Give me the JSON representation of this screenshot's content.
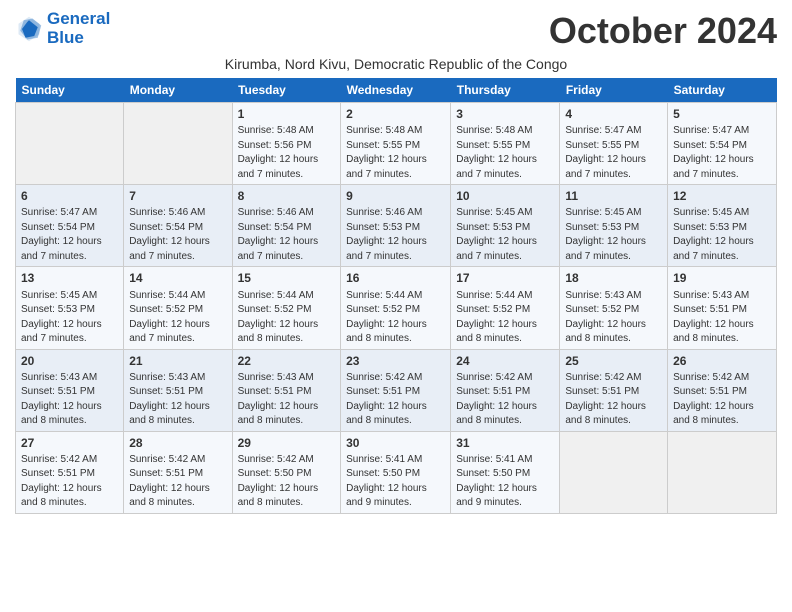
{
  "header": {
    "logo_line1": "General",
    "logo_line2": "Blue",
    "month": "October 2024",
    "location": "Kirumba, Nord Kivu, Democratic Republic of the Congo"
  },
  "weekdays": [
    "Sunday",
    "Monday",
    "Tuesday",
    "Wednesday",
    "Thursday",
    "Friday",
    "Saturday"
  ],
  "weeks": [
    [
      {
        "day": "",
        "detail": ""
      },
      {
        "day": "",
        "detail": ""
      },
      {
        "day": "1",
        "detail": "Sunrise: 5:48 AM\nSunset: 5:56 PM\nDaylight: 12 hours\nand 7 minutes."
      },
      {
        "day": "2",
        "detail": "Sunrise: 5:48 AM\nSunset: 5:55 PM\nDaylight: 12 hours\nand 7 minutes."
      },
      {
        "day": "3",
        "detail": "Sunrise: 5:48 AM\nSunset: 5:55 PM\nDaylight: 12 hours\nand 7 minutes."
      },
      {
        "day": "4",
        "detail": "Sunrise: 5:47 AM\nSunset: 5:55 PM\nDaylight: 12 hours\nand 7 minutes."
      },
      {
        "day": "5",
        "detail": "Sunrise: 5:47 AM\nSunset: 5:54 PM\nDaylight: 12 hours\nand 7 minutes."
      }
    ],
    [
      {
        "day": "6",
        "detail": "Sunrise: 5:47 AM\nSunset: 5:54 PM\nDaylight: 12 hours\nand 7 minutes."
      },
      {
        "day": "7",
        "detail": "Sunrise: 5:46 AM\nSunset: 5:54 PM\nDaylight: 12 hours\nand 7 minutes."
      },
      {
        "day": "8",
        "detail": "Sunrise: 5:46 AM\nSunset: 5:54 PM\nDaylight: 12 hours\nand 7 minutes."
      },
      {
        "day": "9",
        "detail": "Sunrise: 5:46 AM\nSunset: 5:53 PM\nDaylight: 12 hours\nand 7 minutes."
      },
      {
        "day": "10",
        "detail": "Sunrise: 5:45 AM\nSunset: 5:53 PM\nDaylight: 12 hours\nand 7 minutes."
      },
      {
        "day": "11",
        "detail": "Sunrise: 5:45 AM\nSunset: 5:53 PM\nDaylight: 12 hours\nand 7 minutes."
      },
      {
        "day": "12",
        "detail": "Sunrise: 5:45 AM\nSunset: 5:53 PM\nDaylight: 12 hours\nand 7 minutes."
      }
    ],
    [
      {
        "day": "13",
        "detail": "Sunrise: 5:45 AM\nSunset: 5:53 PM\nDaylight: 12 hours\nand 7 minutes."
      },
      {
        "day": "14",
        "detail": "Sunrise: 5:44 AM\nSunset: 5:52 PM\nDaylight: 12 hours\nand 7 minutes."
      },
      {
        "day": "15",
        "detail": "Sunrise: 5:44 AM\nSunset: 5:52 PM\nDaylight: 12 hours\nand 8 minutes."
      },
      {
        "day": "16",
        "detail": "Sunrise: 5:44 AM\nSunset: 5:52 PM\nDaylight: 12 hours\nand 8 minutes."
      },
      {
        "day": "17",
        "detail": "Sunrise: 5:44 AM\nSunset: 5:52 PM\nDaylight: 12 hours\nand 8 minutes."
      },
      {
        "day": "18",
        "detail": "Sunrise: 5:43 AM\nSunset: 5:52 PM\nDaylight: 12 hours\nand 8 minutes."
      },
      {
        "day": "19",
        "detail": "Sunrise: 5:43 AM\nSunset: 5:51 PM\nDaylight: 12 hours\nand 8 minutes."
      }
    ],
    [
      {
        "day": "20",
        "detail": "Sunrise: 5:43 AM\nSunset: 5:51 PM\nDaylight: 12 hours\nand 8 minutes."
      },
      {
        "day": "21",
        "detail": "Sunrise: 5:43 AM\nSunset: 5:51 PM\nDaylight: 12 hours\nand 8 minutes."
      },
      {
        "day": "22",
        "detail": "Sunrise: 5:43 AM\nSunset: 5:51 PM\nDaylight: 12 hours\nand 8 minutes."
      },
      {
        "day": "23",
        "detail": "Sunrise: 5:42 AM\nSunset: 5:51 PM\nDaylight: 12 hours\nand 8 minutes."
      },
      {
        "day": "24",
        "detail": "Sunrise: 5:42 AM\nSunset: 5:51 PM\nDaylight: 12 hours\nand 8 minutes."
      },
      {
        "day": "25",
        "detail": "Sunrise: 5:42 AM\nSunset: 5:51 PM\nDaylight: 12 hours\nand 8 minutes."
      },
      {
        "day": "26",
        "detail": "Sunrise: 5:42 AM\nSunset: 5:51 PM\nDaylight: 12 hours\nand 8 minutes."
      }
    ],
    [
      {
        "day": "27",
        "detail": "Sunrise: 5:42 AM\nSunset: 5:51 PM\nDaylight: 12 hours\nand 8 minutes."
      },
      {
        "day": "28",
        "detail": "Sunrise: 5:42 AM\nSunset: 5:51 PM\nDaylight: 12 hours\nand 8 minutes."
      },
      {
        "day": "29",
        "detail": "Sunrise: 5:42 AM\nSunset: 5:50 PM\nDaylight: 12 hours\nand 8 minutes."
      },
      {
        "day": "30",
        "detail": "Sunrise: 5:41 AM\nSunset: 5:50 PM\nDaylight: 12 hours\nand 9 minutes."
      },
      {
        "day": "31",
        "detail": "Sunrise: 5:41 AM\nSunset: 5:50 PM\nDaylight: 12 hours\nand 9 minutes."
      },
      {
        "day": "",
        "detail": ""
      },
      {
        "day": "",
        "detail": ""
      }
    ]
  ]
}
